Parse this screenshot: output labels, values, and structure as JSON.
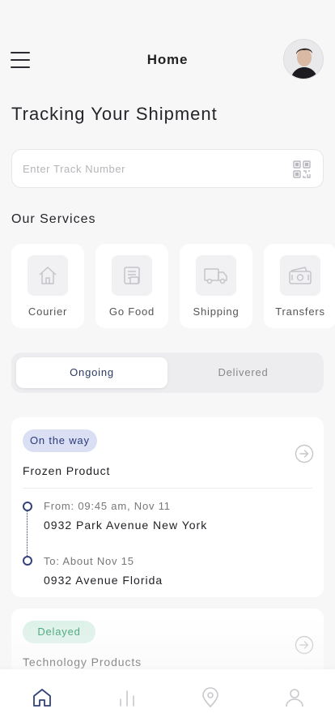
{
  "header": {
    "title": "Home",
    "avatar_icon": "user-avatar"
  },
  "page": {
    "title": "Tracking Your Shipment"
  },
  "search": {
    "placeholder": "Enter Track Number",
    "value": "",
    "action_icon": "qr-code-icon"
  },
  "services": {
    "title": "Our Services",
    "items": [
      {
        "label": "Courier",
        "icon": "home-icon"
      },
      {
        "label": "Go Food",
        "icon": "food-icon"
      },
      {
        "label": "Shipping",
        "icon": "truck-icon"
      },
      {
        "label": "Transfers",
        "icon": "money-icon"
      }
    ]
  },
  "tabs": {
    "items": [
      {
        "label": "Ongoing",
        "active": true
      },
      {
        "label": "Delivered",
        "active": false
      }
    ]
  },
  "shipments": [
    {
      "status": "On the way",
      "status_color": "#dadff3",
      "name": "Frozen Product",
      "from_label": "From: 09:45 am, Nov 11",
      "from_value": "0932 Park Avenue New York",
      "to_label": "To: About Nov 15",
      "to_value": "0932 Avenue Florida"
    },
    {
      "status": "Delayed",
      "status_color": "#dcf1e8",
      "name": "Technology Products"
    }
  ],
  "bottom_nav": {
    "items": [
      {
        "icon": "home-icon",
        "active": true
      },
      {
        "icon": "chart-icon",
        "active": false
      },
      {
        "icon": "location-icon",
        "active": false
      },
      {
        "icon": "profile-icon",
        "active": false
      }
    ]
  },
  "colors": {
    "accent": "#33427a",
    "background": "#f7f7f8",
    "card": "#ffffff"
  }
}
